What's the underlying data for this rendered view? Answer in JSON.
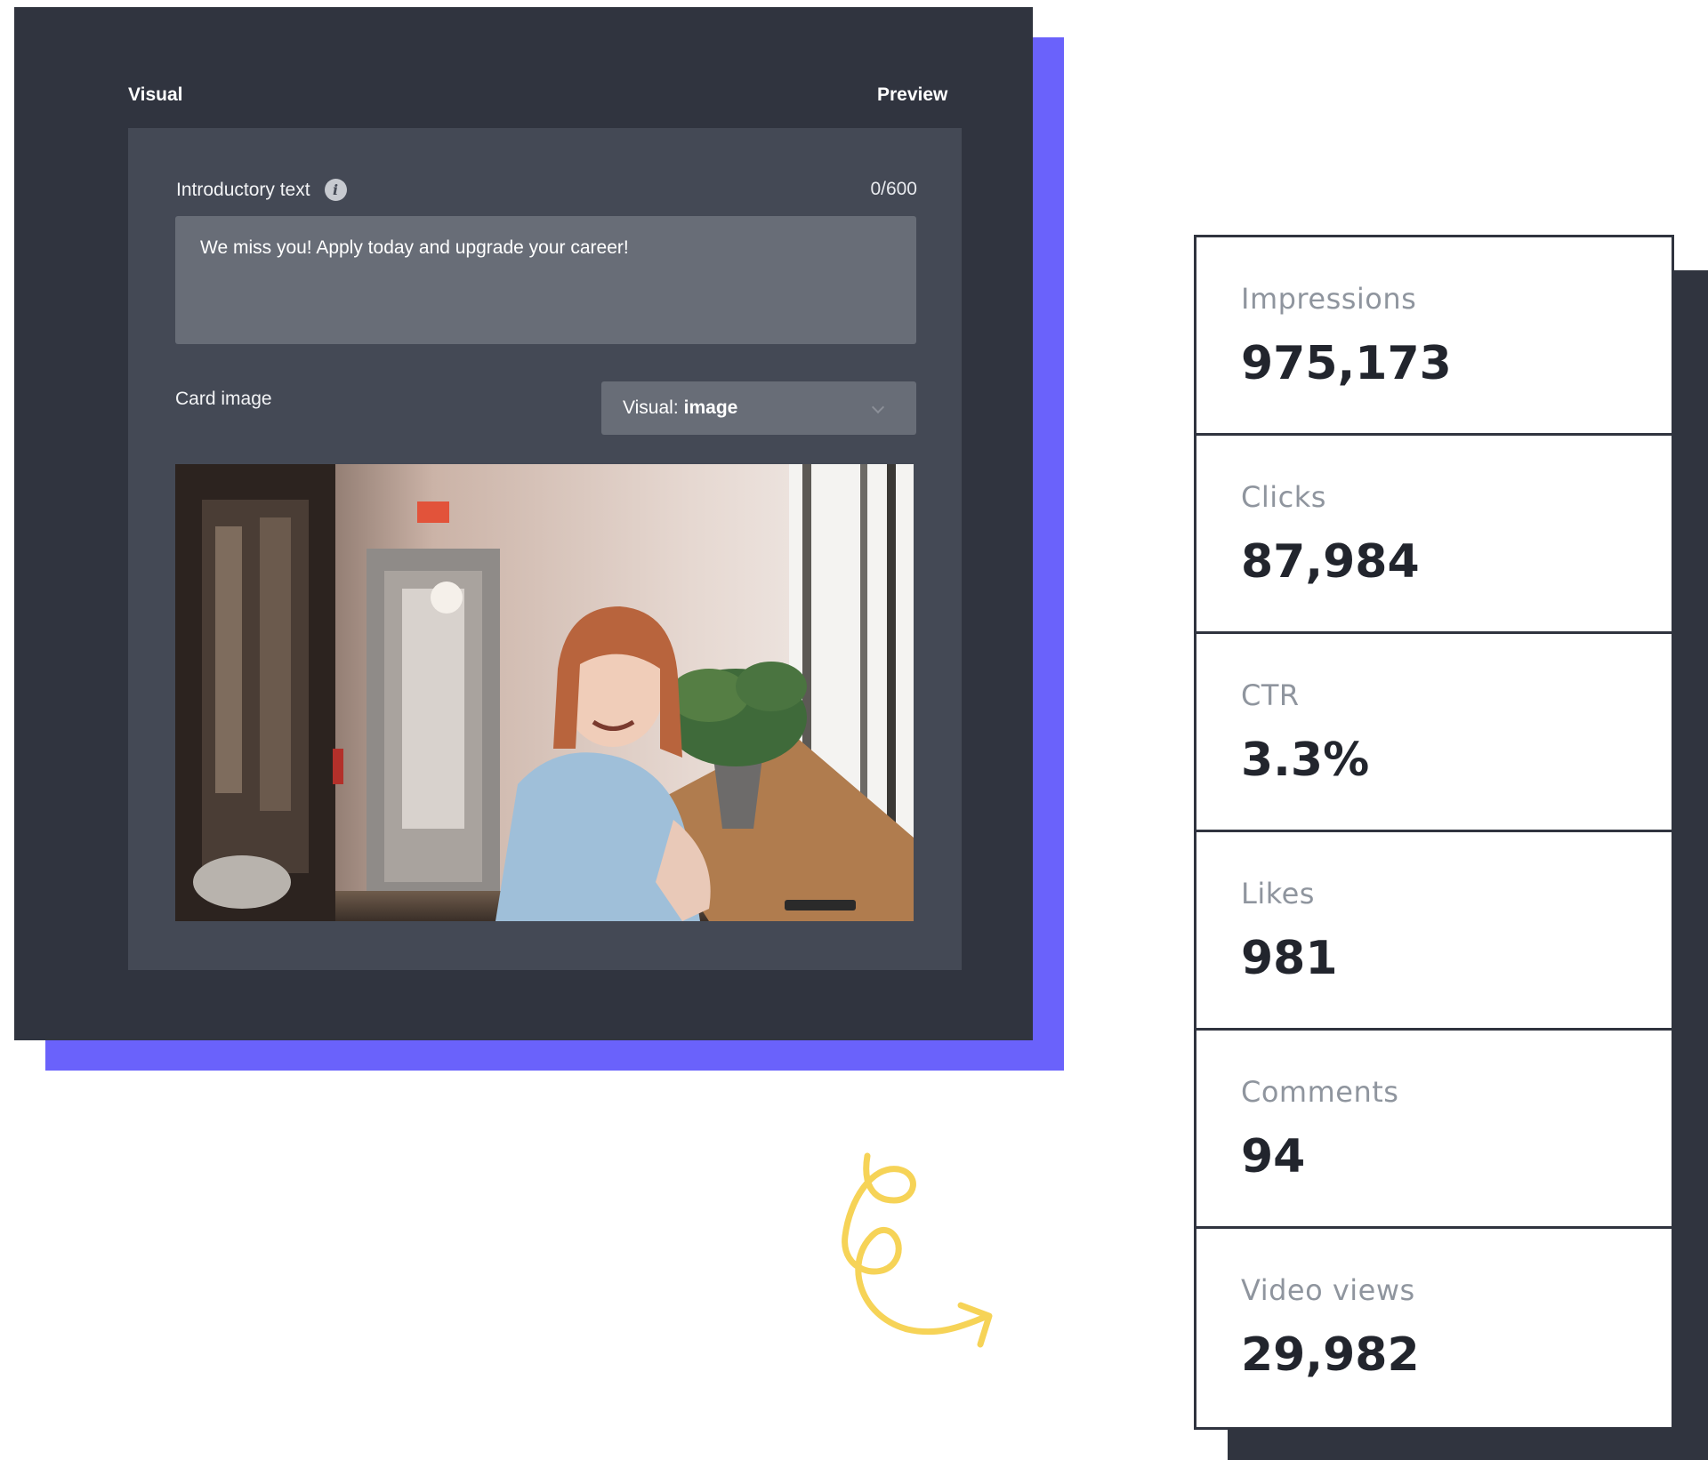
{
  "editor": {
    "tabs": {
      "visual": "Visual",
      "preview": "Preview"
    },
    "intro": {
      "label": "Introductory text",
      "counter": "0/600",
      "value": "We miss you! Apply today and upgrade your career!"
    },
    "card_image": {
      "label": "Card image",
      "select_prefix": "Visual:",
      "select_value": "image"
    },
    "photo_description_icon": "photo-icon",
    "colors": {
      "panel": "#30343f",
      "form": "#444955",
      "accent": "#6a62fb"
    }
  },
  "metrics": [
    {
      "label": "Impressions",
      "value": "975,173"
    },
    {
      "label": "Clicks",
      "value": "87,984"
    },
    {
      "label": "CTR",
      "value": "3.3%"
    },
    {
      "label": "Likes",
      "value": "981"
    },
    {
      "label": "Comments",
      "value": "94"
    },
    {
      "label": "Video views",
      "value": "29,982"
    }
  ],
  "decoration": {
    "squiggle_color": "#f6d357"
  }
}
